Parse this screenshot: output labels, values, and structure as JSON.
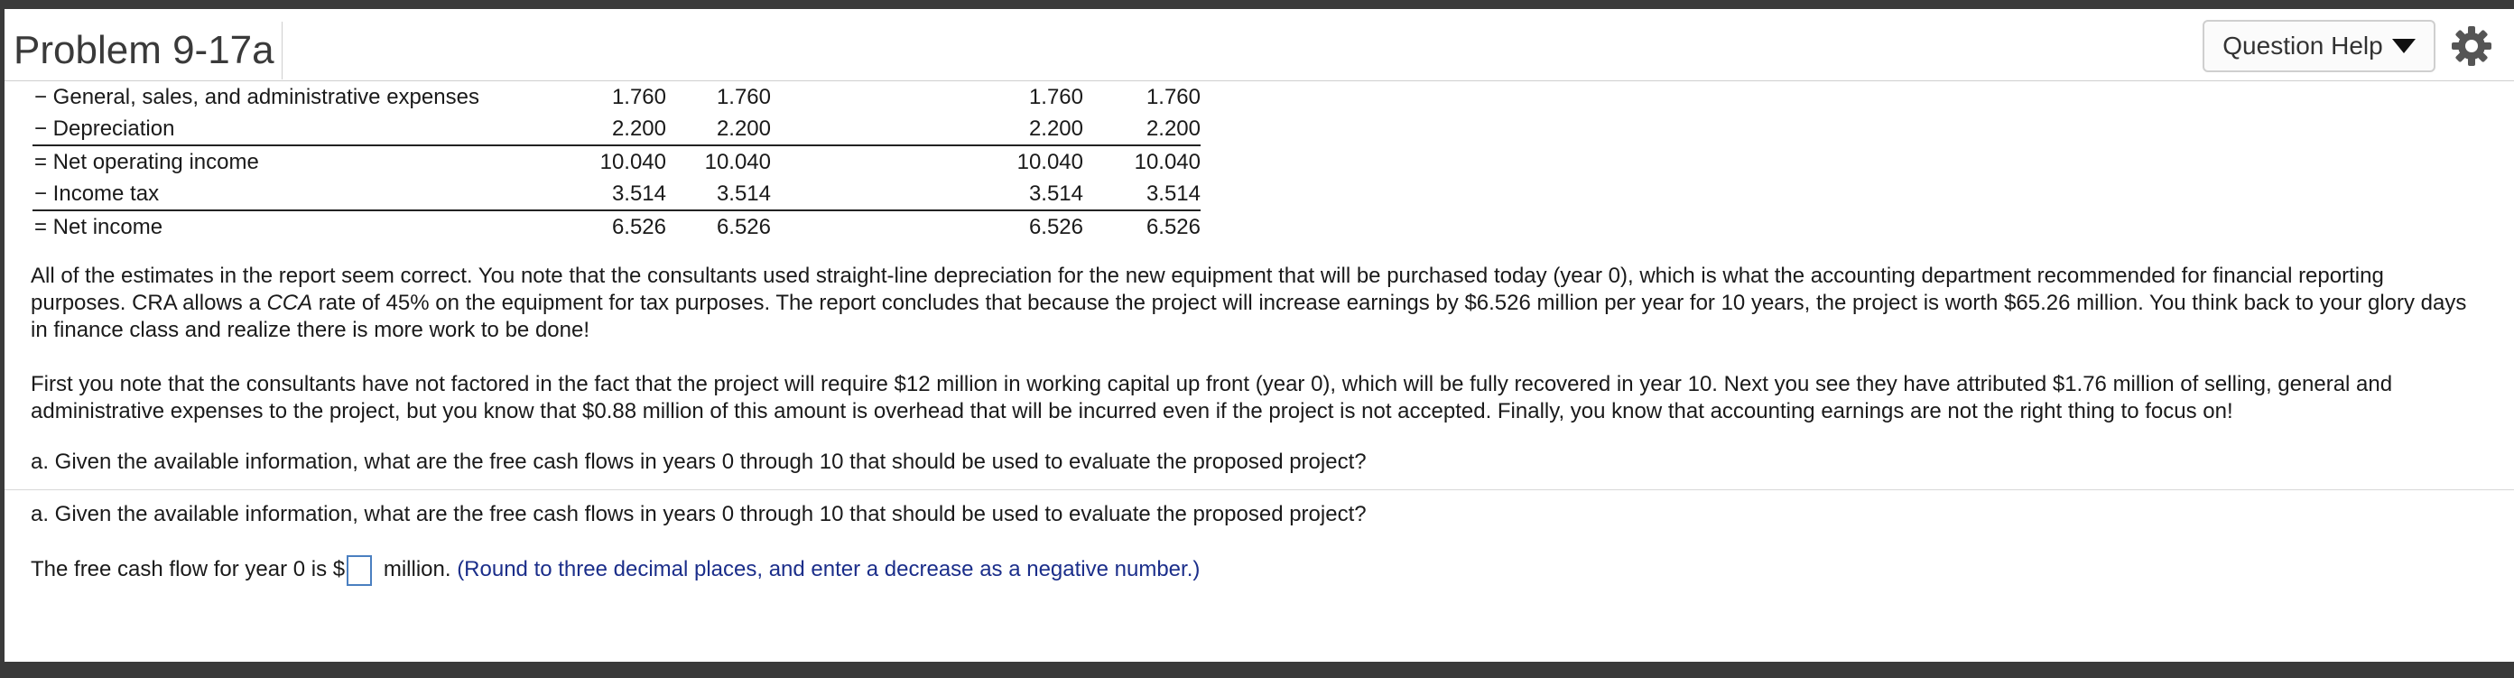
{
  "header": {
    "title": "Problem 9-17a",
    "question_help_label": "Question Help"
  },
  "table": {
    "rows": [
      {
        "label": "− General, sales, and administrative expenses",
        "values": [
          "1.760",
          "1.760",
          "1.760",
          "1.760"
        ]
      },
      {
        "label": "− Depreciation",
        "values": [
          "2.200",
          "2.200",
          "2.200",
          "2.200"
        ]
      },
      {
        "label": "= Net operating income",
        "values": [
          "10.040",
          "10.040",
          "10.040",
          "10.040"
        ]
      },
      {
        "label": "− Income tax",
        "values": [
          "3.514",
          "3.514",
          "3.514",
          "3.514"
        ]
      },
      {
        "label": "= Net income",
        "values": [
          "6.526",
          "6.526",
          "6.526",
          "6.526"
        ]
      }
    ]
  },
  "paragraph1": {
    "part1": "All of the estimates in the report seem correct. You note that the consultants used straight-line depreciation for the new equipment that will be purchased today (year 0), which is what the accounting department recommended for financial reporting purposes. CRA allows a ",
    "italic": "CCA",
    "part2": " rate of 45% on the equipment for tax purposes. The report concludes that because the project will increase earnings by $6.526 million per year for 10 years, the project is worth $65.26 million. You think back to your glory days in finance class and realize there is more work to be done!"
  },
  "paragraph2": "First you note that the consultants have not factored in the fact that the project will require $12 million in working capital up front (year 0), which will be fully recovered in year 10. Next you see they have attributed $1.76 million of selling, general and administrative expenses to the project, but you know that $0.88 million of this amount is overhead that will be incurred even if the project is not accepted. Finally, you know that accounting earnings are not the right thing to focus on!",
  "question_a": "a. Given the available information, what are the free cash flows in years 0 through 10 that should be used to evaluate the proposed project?",
  "question_a_repeat": "a. Given the available information, what are the free cash flows in years 0 through 10 that should be used to evaluate the proposed project?",
  "answer": {
    "prefix": "The free cash flow for year 0 is $",
    "input_value": "",
    "suffix": " million. ",
    "hint": "(Round to three decimal places, and enter a decrease as a negative number.)"
  },
  "colors": {
    "hint_text": "#1b2e8a",
    "input_border": "#4a7fc0",
    "frame": "#3a3a3a"
  },
  "icons": [
    "caret-down-icon",
    "gear-icon"
  ]
}
